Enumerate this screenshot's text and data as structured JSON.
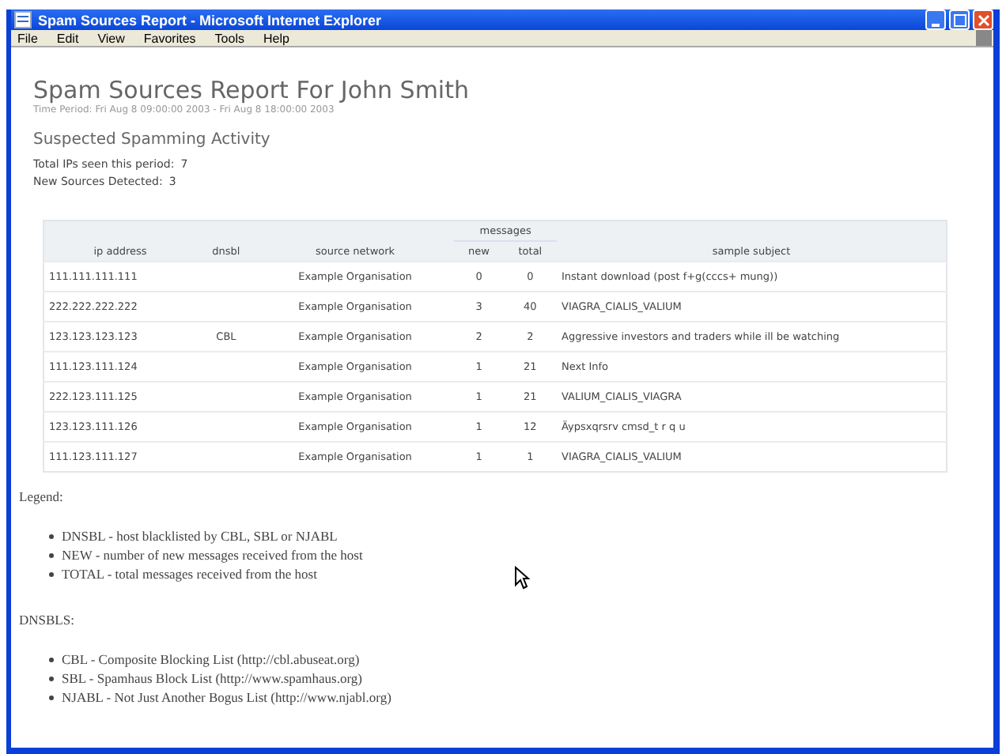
{
  "window": {
    "title": "Spam Sources Report - Microsoft Internet Explorer"
  },
  "menu": [
    "File",
    "Edit",
    "View",
    "Favorites",
    "Tools",
    "Help"
  ],
  "report": {
    "title": "Spam Sources Report For John Smith",
    "period": "Time Period: Fri Aug 8 09:00:00 2003 - Fri Aug 8 18:00:00 2003",
    "section": "Suspected Spamming Activity",
    "stats": [
      {
        "label": "Total IPs seen this period:",
        "value": "7"
      },
      {
        "label": "New Sources Detected:",
        "value": "3"
      }
    ]
  },
  "table": {
    "group_header": "messages",
    "columns": [
      "ip address",
      "dnsbl",
      "source network",
      "new",
      "total",
      "sample subject"
    ],
    "rows": [
      [
        "111.111.111.111",
        "",
        "Example Organisation",
        "0",
        "0",
        "Instant download (post f+g(cccs+ mung))"
      ],
      [
        "222.222.222.222",
        "",
        "Example Organisation",
        "3",
        "40",
        "VIAGRA_CIALIS_VALIUM"
      ],
      [
        "123.123.123.123",
        "CBL",
        "Example Organisation",
        "2",
        "2",
        "Aggressive investors and traders while ill be watching"
      ],
      [
        "111.123.111.124",
        "",
        "Example Organisation",
        "1",
        "21",
        "Next Info"
      ],
      [
        "222.123.111.125",
        "",
        "Example Organisation",
        "1",
        "21",
        "VALIUM_CIALIS_VIAGRA"
      ],
      [
        "123.123.111.126",
        "",
        "Example Organisation",
        "1",
        "12",
        "Äypsxqrsrv cmsd_t r q u"
      ],
      [
        "111.123.111.127",
        "",
        "Example Organisation",
        "1",
        "1",
        "VIAGRA_CIALIS_VALIUM"
      ]
    ]
  },
  "legend": {
    "title": "Legend:",
    "items": [
      "DNSBL - host blacklisted by CBL, SBL or NJABL",
      "NEW - number of new messages received from the host",
      "TOTAL - total messages received from the host"
    ]
  },
  "dnsbls": {
    "title": "DNSBLS:",
    "items": [
      "CBL - Composite Blocking List (http://cbl.abuseat.org)",
      "SBL - Spamhaus Block List (http://www.spamhaus.org)",
      "NJABL - Not Just Another Bogus List (http://www.njabl.org)"
    ]
  }
}
